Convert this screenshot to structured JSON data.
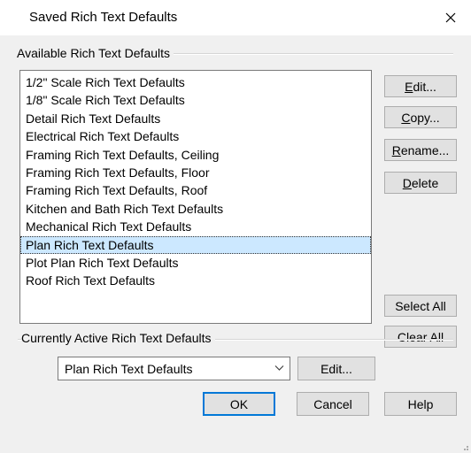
{
  "window": {
    "title": "Saved Rich Text Defaults"
  },
  "available_group": {
    "label": "Available Rich Text Defaults"
  },
  "list": {
    "items": [
      "1/2\" Scale Rich Text Defaults",
      "1/8\" Scale Rich Text Defaults",
      "Detail Rich Text Defaults",
      "Electrical Rich Text Defaults",
      "Framing Rich Text Defaults, Ceiling",
      "Framing Rich Text Defaults, Floor",
      "Framing Rich Text Defaults, Roof",
      "Kitchen and Bath Rich Text Defaults",
      "Mechanical Rich Text Defaults",
      "Plan Rich Text Defaults",
      "Plot Plan Rich Text Defaults",
      "Roof Rich Text Defaults"
    ],
    "selected_index": 9
  },
  "side_buttons": {
    "edit": {
      "mnemonic": "E",
      "rest": "dit..."
    },
    "copy": {
      "mnemonic": "C",
      "rest": "opy..."
    },
    "rename": {
      "mnemonic": "R",
      "rest": "ename..."
    },
    "delete": {
      "mnemonic": "D",
      "rest": "elete"
    },
    "select_all": "Select All",
    "clear_all": "Clear All"
  },
  "active_group": {
    "label": "Currently Active Rich Text Defaults",
    "selected_value": "Plan Rich Text Defaults",
    "edit_label": "Edit..."
  },
  "footer": {
    "ok": "OK",
    "cancel": "Cancel",
    "help": "Help"
  },
  "colors": {
    "selection": "#cce8ff",
    "default_button_border": "#0078d7",
    "window_bg": "#f0f0f0"
  },
  "icons": {
    "close": "close-icon",
    "combo_arrow": "chevron-down-icon",
    "resize": "resize-grip-icon"
  }
}
